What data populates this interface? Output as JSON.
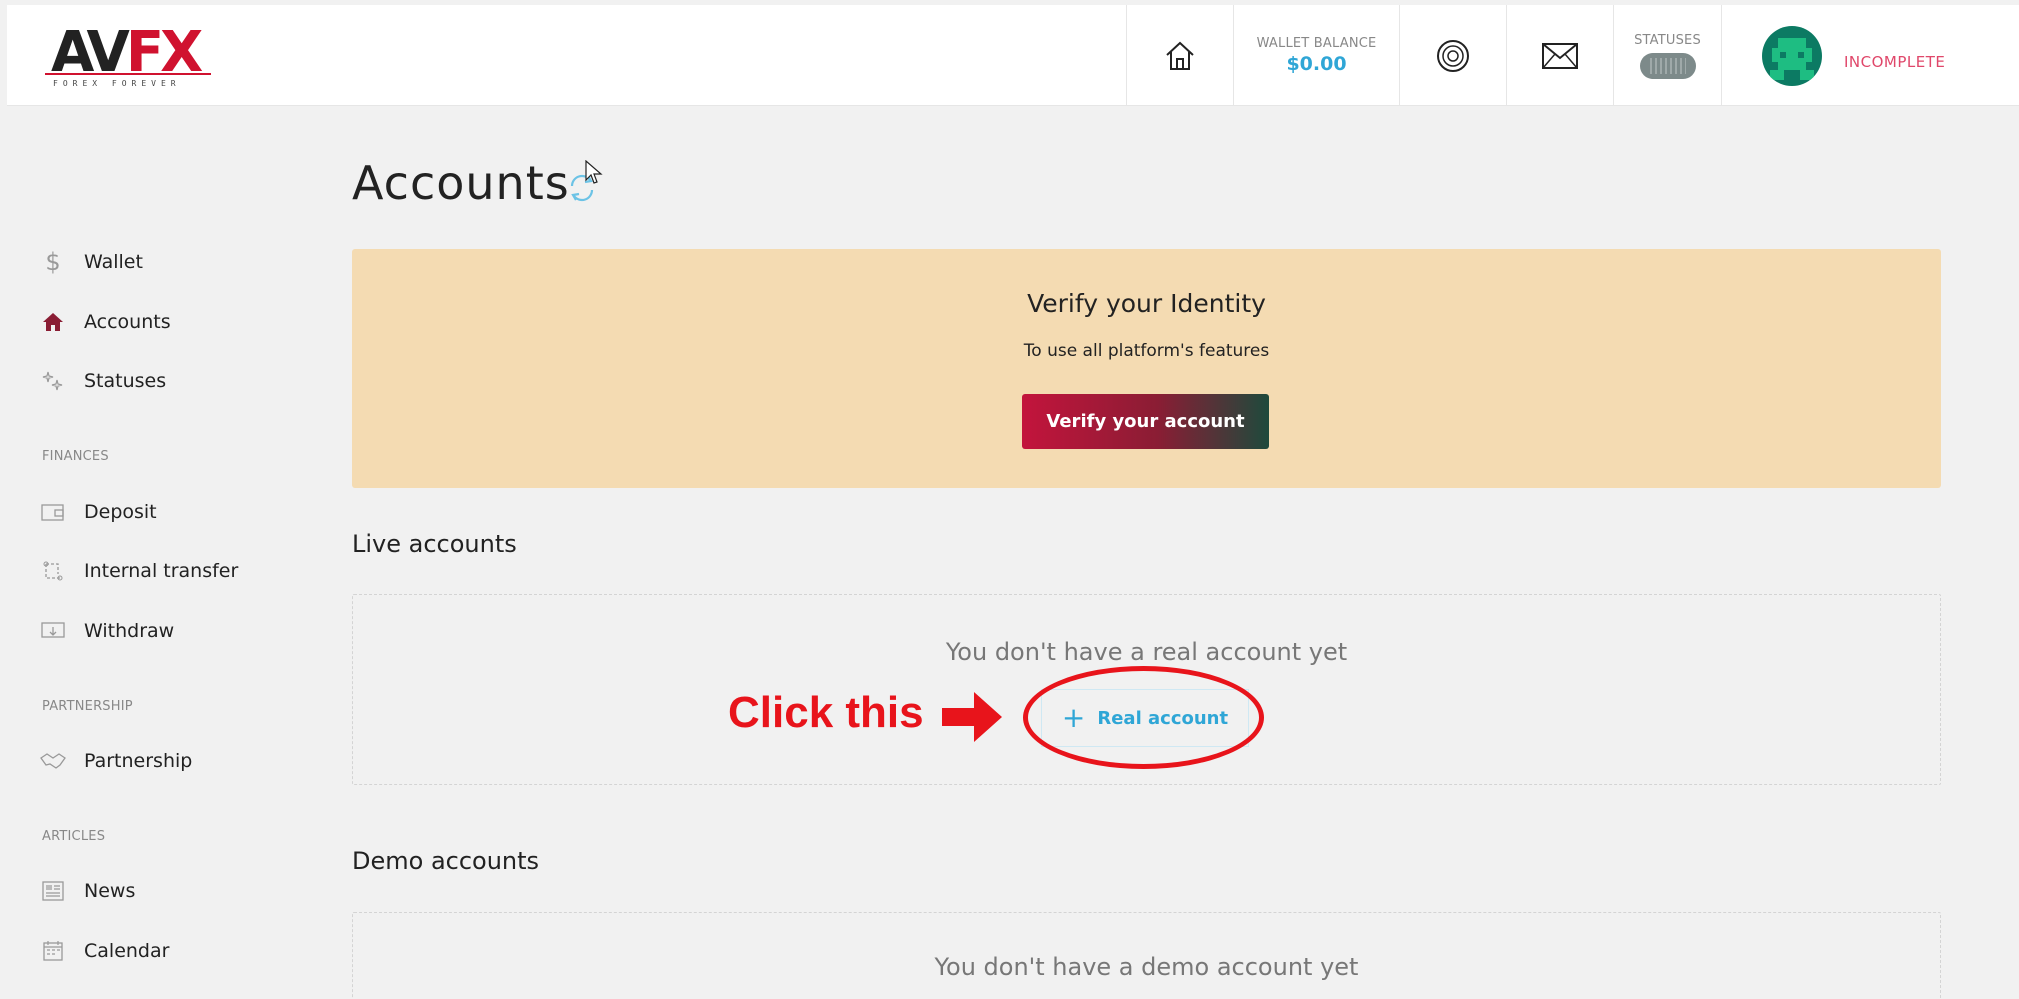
{
  "brand": {
    "name_a": "AV",
    "name_b": "FX",
    "tagline": "FOREX FOREVER"
  },
  "header": {
    "wallet_label": "WALLET BALANCE",
    "wallet_value": "$0.00",
    "statuses_label": "STATUSES",
    "user_status": "INCOMPLETE"
  },
  "sidebar": {
    "items": [
      {
        "label": "Wallet",
        "icon": "dollar-icon"
      },
      {
        "label": "Accounts",
        "icon": "home-icon"
      },
      {
        "label": "Statuses",
        "icon": "sparkles-icon"
      }
    ],
    "finances_label": "FINANCES",
    "finances_items": [
      {
        "label": "Deposit",
        "icon": "wallet-icon"
      },
      {
        "label": "Internal transfer",
        "icon": "transfer-icon"
      },
      {
        "label": "Withdraw",
        "icon": "withdraw-icon"
      }
    ],
    "partnership_label": "PARTNERSHIP",
    "partnership_items": [
      {
        "label": "Partnership",
        "icon": "handshake-icon"
      }
    ],
    "articles_label": "ARTICLES",
    "articles_items": [
      {
        "label": "News",
        "icon": "newspaper-icon"
      },
      {
        "label": "Calendar",
        "icon": "calendar-icon"
      }
    ]
  },
  "main": {
    "title": "Accounts",
    "verify": {
      "title": "Verify your Identity",
      "subtitle": "To use all platform's features",
      "button": "Verify your account"
    },
    "live": {
      "title": "Live accounts",
      "empty": "You don't have a real account yet",
      "button": "Real account"
    },
    "demo": {
      "title": "Demo accounts",
      "empty": "You don't have a demo account yet"
    }
  },
  "annotation": {
    "text": "Click this"
  },
  "colors": {
    "accent": "#2fa6d6",
    "brand_red": "#d0122f",
    "annotation_red": "#e8141b",
    "banner": "#f4dbb2"
  }
}
